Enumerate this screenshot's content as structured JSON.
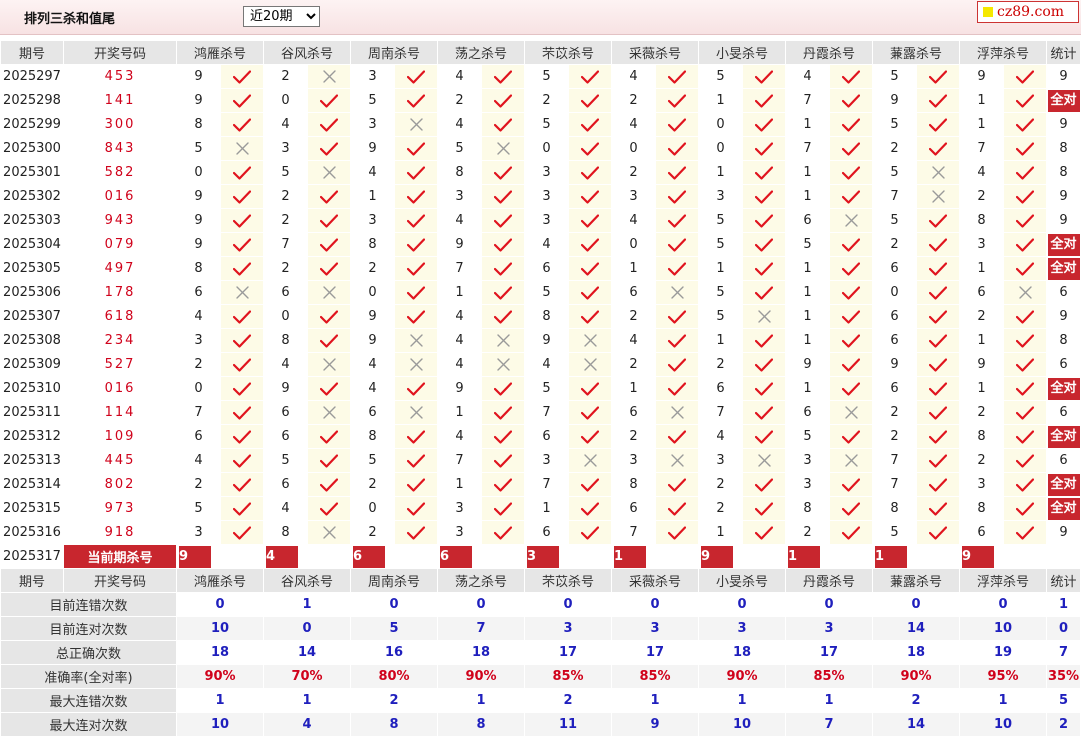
{
  "header": {
    "title": "排列三杀和值尾",
    "period_select": "近20期",
    "logo": "cz89.com"
  },
  "columns": {
    "period": "期号",
    "draw": "开奖号码",
    "experts": [
      "鸿雁杀号",
      "谷风杀号",
      "周南杀号",
      "荡之杀号",
      "芣苡杀号",
      "采薇杀号",
      "小旻杀号",
      "丹霞杀号",
      "蒹露杀号",
      "浮萍杀号"
    ],
    "stat": "统计"
  },
  "rows": [
    {
      "period": "2025297",
      "draw": "453",
      "kills": [
        [
          9,
          1
        ],
        [
          2,
          0
        ],
        [
          3,
          1
        ],
        [
          4,
          1
        ],
        [
          5,
          1
        ],
        [
          4,
          1
        ],
        [
          5,
          1
        ],
        [
          4,
          1
        ],
        [
          5,
          1
        ],
        [
          9,
          1
        ]
      ],
      "stat": "9"
    },
    {
      "period": "2025298",
      "draw": "141",
      "kills": [
        [
          9,
          1
        ],
        [
          0,
          1
        ],
        [
          5,
          1
        ],
        [
          2,
          1
        ],
        [
          2,
          1
        ],
        [
          2,
          1
        ],
        [
          1,
          1
        ],
        [
          7,
          1
        ],
        [
          9,
          1
        ],
        [
          1,
          1
        ]
      ],
      "stat": "全对"
    },
    {
      "period": "2025299",
      "draw": "300",
      "kills": [
        [
          8,
          1
        ],
        [
          4,
          1
        ],
        [
          3,
          0
        ],
        [
          4,
          1
        ],
        [
          5,
          1
        ],
        [
          4,
          1
        ],
        [
          0,
          1
        ],
        [
          1,
          1
        ],
        [
          5,
          1
        ],
        [
          1,
          1
        ]
      ],
      "stat": "9"
    },
    {
      "period": "2025300",
      "draw": "843",
      "kills": [
        [
          5,
          0
        ],
        [
          3,
          1
        ],
        [
          9,
          1
        ],
        [
          5,
          0
        ],
        [
          0,
          1
        ],
        [
          0,
          1
        ],
        [
          0,
          1
        ],
        [
          7,
          1
        ],
        [
          2,
          1
        ],
        [
          7,
          1
        ]
      ],
      "stat": "8"
    },
    {
      "period": "2025301",
      "draw": "582",
      "kills": [
        [
          0,
          1
        ],
        [
          5,
          0
        ],
        [
          4,
          1
        ],
        [
          8,
          1
        ],
        [
          3,
          1
        ],
        [
          2,
          1
        ],
        [
          1,
          1
        ],
        [
          1,
          1
        ],
        [
          5,
          0
        ],
        [
          4,
          1
        ]
      ],
      "stat": "8"
    },
    {
      "period": "2025302",
      "draw": "016",
      "kills": [
        [
          9,
          1
        ],
        [
          2,
          1
        ],
        [
          1,
          1
        ],
        [
          3,
          1
        ],
        [
          3,
          1
        ],
        [
          3,
          1
        ],
        [
          3,
          1
        ],
        [
          1,
          1
        ],
        [
          7,
          0
        ],
        [
          2,
          1
        ]
      ],
      "stat": "9"
    },
    {
      "period": "2025303",
      "draw": "943",
      "kills": [
        [
          9,
          1
        ],
        [
          2,
          1
        ],
        [
          3,
          1
        ],
        [
          4,
          1
        ],
        [
          3,
          1
        ],
        [
          4,
          1
        ],
        [
          5,
          1
        ],
        [
          6,
          0
        ],
        [
          5,
          1
        ],
        [
          8,
          1
        ]
      ],
      "stat": "9"
    },
    {
      "period": "2025304",
      "draw": "079",
      "kills": [
        [
          9,
          1
        ],
        [
          7,
          1
        ],
        [
          8,
          1
        ],
        [
          9,
          1
        ],
        [
          4,
          1
        ],
        [
          0,
          1
        ],
        [
          5,
          1
        ],
        [
          5,
          1
        ],
        [
          2,
          1
        ],
        [
          3,
          1
        ]
      ],
      "stat": "全对"
    },
    {
      "period": "2025305",
      "draw": "497",
      "kills": [
        [
          8,
          1
        ],
        [
          2,
          1
        ],
        [
          2,
          1
        ],
        [
          7,
          1
        ],
        [
          6,
          1
        ],
        [
          1,
          1
        ],
        [
          1,
          1
        ],
        [
          1,
          1
        ],
        [
          6,
          1
        ],
        [
          1,
          1
        ]
      ],
      "stat": "全对"
    },
    {
      "period": "2025306",
      "draw": "178",
      "kills": [
        [
          6,
          0
        ],
        [
          6,
          0
        ],
        [
          0,
          1
        ],
        [
          1,
          1
        ],
        [
          5,
          1
        ],
        [
          6,
          0
        ],
        [
          5,
          1
        ],
        [
          1,
          1
        ],
        [
          0,
          1
        ],
        [
          6,
          0
        ]
      ],
      "stat": "6"
    },
    {
      "period": "2025307",
      "draw": "618",
      "kills": [
        [
          4,
          1
        ],
        [
          0,
          1
        ],
        [
          9,
          1
        ],
        [
          4,
          1
        ],
        [
          8,
          1
        ],
        [
          2,
          1
        ],
        [
          5,
          0
        ],
        [
          1,
          1
        ],
        [
          6,
          1
        ],
        [
          2,
          1
        ]
      ],
      "stat": "9"
    },
    {
      "period": "2025308",
      "draw": "234",
      "kills": [
        [
          3,
          1
        ],
        [
          8,
          1
        ],
        [
          9,
          0
        ],
        [
          4,
          0
        ],
        [
          9,
          0
        ],
        [
          4,
          1
        ],
        [
          1,
          1
        ],
        [
          1,
          1
        ],
        [
          6,
          1
        ],
        [
          1,
          1
        ]
      ],
      "stat": "8"
    },
    {
      "period": "2025309",
      "draw": "527",
      "kills": [
        [
          2,
          1
        ],
        [
          4,
          0
        ],
        [
          4,
          0
        ],
        [
          4,
          0
        ],
        [
          4,
          0
        ],
        [
          2,
          1
        ],
        [
          2,
          1
        ],
        [
          9,
          1
        ],
        [
          9,
          1
        ],
        [
          9,
          1
        ]
      ],
      "stat": "6"
    },
    {
      "period": "2025310",
      "draw": "016",
      "kills": [
        [
          0,
          1
        ],
        [
          9,
          1
        ],
        [
          4,
          1
        ],
        [
          9,
          1
        ],
        [
          5,
          1
        ],
        [
          1,
          1
        ],
        [
          6,
          1
        ],
        [
          1,
          1
        ],
        [
          6,
          1
        ],
        [
          1,
          1
        ]
      ],
      "stat": "全对"
    },
    {
      "period": "2025311",
      "draw": "114",
      "kills": [
        [
          7,
          1
        ],
        [
          6,
          0
        ],
        [
          6,
          0
        ],
        [
          1,
          1
        ],
        [
          7,
          1
        ],
        [
          6,
          0
        ],
        [
          7,
          1
        ],
        [
          6,
          0
        ],
        [
          2,
          1
        ],
        [
          2,
          1
        ]
      ],
      "stat": "6"
    },
    {
      "period": "2025312",
      "draw": "109",
      "kills": [
        [
          6,
          1
        ],
        [
          6,
          1
        ],
        [
          8,
          1
        ],
        [
          4,
          1
        ],
        [
          6,
          1
        ],
        [
          2,
          1
        ],
        [
          4,
          1
        ],
        [
          5,
          1
        ],
        [
          2,
          1
        ],
        [
          8,
          1
        ]
      ],
      "stat": "全对"
    },
    {
      "period": "2025313",
      "draw": "445",
      "kills": [
        [
          4,
          1
        ],
        [
          5,
          1
        ],
        [
          5,
          1
        ],
        [
          7,
          1
        ],
        [
          3,
          0
        ],
        [
          3,
          0
        ],
        [
          3,
          0
        ],
        [
          3,
          0
        ],
        [
          7,
          1
        ],
        [
          2,
          1
        ]
      ],
      "stat": "6"
    },
    {
      "period": "2025314",
      "draw": "802",
      "kills": [
        [
          2,
          1
        ],
        [
          6,
          1
        ],
        [
          2,
          1
        ],
        [
          1,
          1
        ],
        [
          7,
          1
        ],
        [
          8,
          1
        ],
        [
          2,
          1
        ],
        [
          3,
          1
        ],
        [
          7,
          1
        ],
        [
          3,
          1
        ]
      ],
      "stat": "全对"
    },
    {
      "period": "2025315",
      "draw": "973",
      "kills": [
        [
          5,
          1
        ],
        [
          4,
          1
        ],
        [
          0,
          1
        ],
        [
          3,
          1
        ],
        [
          1,
          1
        ],
        [
          6,
          1
        ],
        [
          2,
          1
        ],
        [
          8,
          1
        ],
        [
          8,
          1
        ],
        [
          8,
          1
        ]
      ],
      "stat": "全对"
    },
    {
      "period": "2025316",
      "draw": "918",
      "kills": [
        [
          3,
          1
        ],
        [
          8,
          0
        ],
        [
          2,
          1
        ],
        [
          3,
          1
        ],
        [
          6,
          1
        ],
        [
          7,
          1
        ],
        [
          1,
          1
        ],
        [
          2,
          1
        ],
        [
          5,
          1
        ],
        [
          6,
          1
        ]
      ],
      "stat": "9"
    }
  ],
  "current": {
    "period": "2025317",
    "label": "当前期杀号",
    "kills": [
      "9",
      "4",
      "6",
      "6",
      "3",
      "1",
      "9",
      "1",
      "1",
      "9"
    ]
  },
  "stats": [
    {
      "label": "目前连错次数",
      "values": [
        "0",
        "1",
        "0",
        "0",
        "0",
        "0",
        "0",
        "0",
        "0",
        "0",
        "1"
      ],
      "type": "num"
    },
    {
      "label": "目前连对次数",
      "values": [
        "10",
        "0",
        "5",
        "7",
        "3",
        "3",
        "3",
        "3",
        "14",
        "10",
        "0"
      ],
      "type": "num"
    },
    {
      "label": "总正确次数",
      "values": [
        "18",
        "14",
        "16",
        "18",
        "17",
        "17",
        "18",
        "17",
        "18",
        "19",
        "7"
      ],
      "type": "num"
    },
    {
      "label": "准确率(全对率)",
      "values": [
        "90%",
        "70%",
        "80%",
        "90%",
        "85%",
        "85%",
        "90%",
        "85%",
        "90%",
        "95%",
        "35%"
      ],
      "type": "pct"
    },
    {
      "label": "最大连错次数",
      "values": [
        "1",
        "1",
        "2",
        "1",
        "2",
        "1",
        "1",
        "1",
        "2",
        "1",
        "5"
      ],
      "type": "num"
    },
    {
      "label": "最大连对次数",
      "values": [
        "10",
        "4",
        "8",
        "8",
        "11",
        "9",
        "10",
        "7",
        "14",
        "10",
        "2"
      ],
      "type": "num"
    }
  ],
  "colors": {
    "correct": "#e0141e",
    "wrong": "#9a9a9a",
    "highlight": "#c8262e",
    "stat_blue": "#1f1fbd",
    "header_gray": "#e6e6e6",
    "mark_bg": "#fdfbe7"
  }
}
